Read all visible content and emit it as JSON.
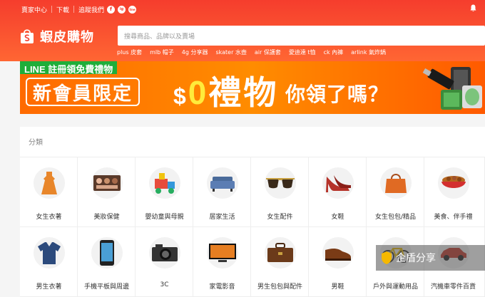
{
  "topbar": {
    "seller_center": "賣家中心",
    "download": "下載",
    "follow": "追蹤我們",
    "social": [
      "f",
      "ig",
      "line"
    ]
  },
  "logo": {
    "text": "蝦皮購物"
  },
  "search": {
    "placeholder": "搜尋商品、品牌以及賣場"
  },
  "hot_keywords": [
    "plus 皮套",
    "mlb 帽子",
    "4g 分享器",
    "skater 水壺",
    "air 保護套",
    "愛迪達 t恤",
    "ck 內褲",
    "arlink 氣炸鍋"
  ],
  "banner": {
    "line_tag": "LINE 註冊領免費禮物",
    "member": "新會員限定",
    "dollar": "$",
    "zero": "0",
    "gift": "禮物",
    "question": "你領了嗎？"
  },
  "category": {
    "title": "分類",
    "items": [
      {
        "label": "女生衣著",
        "icon": "dress-icon"
      },
      {
        "label": "美妝保健",
        "icon": "makeup-palette-icon"
      },
      {
        "label": "嬰幼童與母親",
        "icon": "toy-train-icon"
      },
      {
        "label": "居家生活",
        "icon": "sofa-icon"
      },
      {
        "label": "女生配件",
        "icon": "sunglasses-icon"
      },
      {
        "label": "女鞋",
        "icon": "high-heel-icon"
      },
      {
        "label": "女生包包/精品",
        "icon": "handbag-icon"
      },
      {
        "label": "美食、伴手禮",
        "icon": "food-bowl-icon"
      },
      {
        "label": "男生衣著",
        "icon": "polo-shirt-icon"
      },
      {
        "label": "手機平板與周邊",
        "icon": "smartphone-icon"
      },
      {
        "label": "3C",
        "icon": "camera-icon"
      },
      {
        "label": "家電影音",
        "icon": "tv-icon"
      },
      {
        "label": "男生包包與配件",
        "icon": "briefcase-icon"
      },
      {
        "label": "男鞋",
        "icon": "mens-shoe-icon"
      },
      {
        "label": "戶外與運動用品",
        "icon": "bicycle-icon"
      },
      {
        "label": "汽機車零件百貨",
        "icon": "car-icon"
      }
    ]
  },
  "watermark": {
    "text": "企盾分享"
  },
  "colors": {
    "brand": "#f53d2d",
    "banner": "#ff6a00",
    "line_green": "#1fae3a"
  }
}
